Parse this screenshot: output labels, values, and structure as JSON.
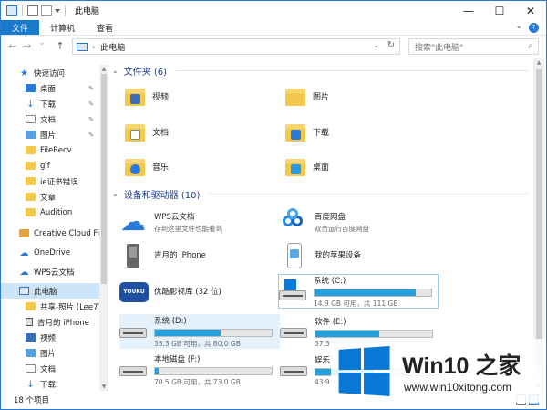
{
  "window": {
    "title": "此电脑",
    "minimize": "—",
    "maximize": "☐",
    "close": "✕"
  },
  "ribbon": {
    "tabs": [
      "文件",
      "计算机",
      "查看"
    ],
    "help": "?"
  },
  "address": {
    "back": "←",
    "forward": "→",
    "recent": "⌄",
    "up": "↑",
    "separator": "›",
    "path": "此电脑",
    "search_placeholder": "搜索\"此电脑\""
  },
  "sidebar": {
    "items": [
      {
        "label": "快速访问",
        "icon": "star-icon"
      },
      {
        "label": "桌面",
        "icon": "desktop-icon",
        "pinned": true
      },
      {
        "label": "下载",
        "icon": "download-icon",
        "pinned": true
      },
      {
        "label": "文档",
        "icon": "documents-icon",
        "pinned": true
      },
      {
        "label": "图片",
        "icon": "pictures-icon",
        "pinned": true
      },
      {
        "label": "FileRecv",
        "icon": "folder-icon"
      },
      {
        "label": "gif",
        "icon": "folder-icon"
      },
      {
        "label": "ie证书错误",
        "icon": "folder-icon"
      },
      {
        "label": "文章",
        "icon": "folder-icon"
      },
      {
        "label": "Audition",
        "icon": "folder-icon"
      },
      {
        "label": "Creative Cloud Fil",
        "icon": "creative-cloud-icon"
      },
      {
        "label": "OneDrive",
        "icon": "onedrive-icon"
      },
      {
        "label": "WPS云文档",
        "icon": "wps-cloud-icon"
      },
      {
        "label": "此电脑",
        "icon": "pc-icon",
        "selected": true
      },
      {
        "label": "共享-照片 (Lee77",
        "icon": "shared-photos-icon"
      },
      {
        "label": "吉月的 iPhone",
        "icon": "phone-icon"
      },
      {
        "label": "视频",
        "icon": "videos-icon"
      },
      {
        "label": "图片",
        "icon": "pictures-icon"
      },
      {
        "label": "文档",
        "icon": "documents-icon"
      },
      {
        "label": "下载",
        "icon": "download-icon"
      }
    ]
  },
  "folders_group": {
    "header": "文件夹 (6)",
    "items": [
      {
        "label": "视频",
        "icon": "videos-folder-icon",
        "badge_color": "#3b6fb5"
      },
      {
        "label": "图片",
        "icon": "pictures-folder-icon",
        "badge_color": "#f2c94c"
      },
      {
        "label": "文档",
        "icon": "documents-folder-icon",
        "badge_color": "#ffffff"
      },
      {
        "label": "下载",
        "icon": "downloads-folder-icon",
        "badge_color": "#2b79d6"
      },
      {
        "label": "音乐",
        "icon": "music-folder-icon",
        "badge_color": "#2b79d6"
      },
      {
        "label": "桌面",
        "icon": "desktop-folder-icon",
        "badge_color": "#2b9be0"
      }
    ]
  },
  "devices_group": {
    "header": "设备和驱动器 (10)",
    "apps": [
      {
        "name": "WPS云文档",
        "sub": "存到这里文件也能看到",
        "icon": "wps-cloud-icon"
      },
      {
        "name": "百度网盘",
        "sub": "双击运行百度网盘",
        "icon": "baidu-netdisk-icon"
      },
      {
        "name": "吉月的 iPhone",
        "sub": "",
        "icon": "iphone-device-icon"
      },
      {
        "name": "我的苹果设备",
        "sub": "",
        "icon": "apple-device-icon"
      },
      {
        "name": "优酷影视库 (32 位)",
        "sub": "",
        "icon": "youku-icon",
        "logo_text": "YOUKU"
      }
    ],
    "drives": [
      {
        "name": "系统 (C:)",
        "sub": "14.9 GB 可用，共 111 GB",
        "used_fraction": 0.866,
        "icon": "system-drive-icon"
      },
      {
        "name": "系统 (D:)",
        "sub": "35.3 GB 可用，共 80.0 GB",
        "used_fraction": 0.559,
        "icon": "hard-drive-icon"
      },
      {
        "name": "软件 (E:)",
        "sub": "37.3",
        "used_fraction": 0.55,
        "icon": "hard-drive-icon"
      },
      {
        "name": "本地磁盘 (F:)",
        "sub": "70.5 GB 可用，共 73.0 GB",
        "used_fraction": 0.034,
        "icon": "hard-drive-icon"
      },
      {
        "name": "娱乐",
        "sub": "43.9",
        "used_fraction": 0.5,
        "icon": "hard-drive-icon"
      }
    ]
  },
  "status": {
    "count": "18 个项目"
  },
  "watermark": {
    "title": "Win10 之家",
    "url": "www.win10xitong.com"
  },
  "colors": {
    "accent": "#2b79d6",
    "file_tab": "#1979ca",
    "drive_fill": "#26a0da",
    "group_header": "#1e3d8f",
    "selection": "#cce4f7"
  }
}
